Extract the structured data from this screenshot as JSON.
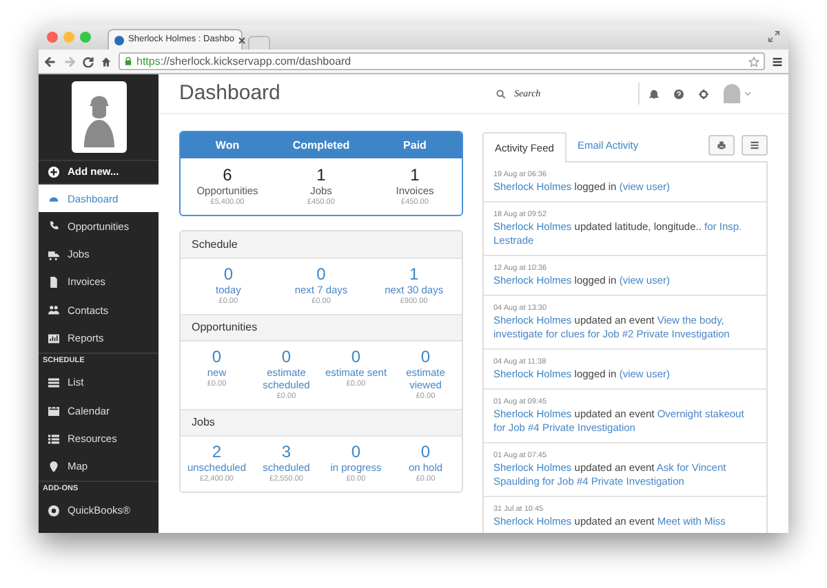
{
  "browser": {
    "tab_title": "Sherlock Holmes : Dashbo",
    "url_scheme": "https",
    "url_rest": "://sherlock.kickservapp.com/dashboard"
  },
  "sidebar": {
    "add_new": "Add new...",
    "sections": [
      {
        "items": [
          {
            "label": "Dashboard",
            "selected": true
          },
          {
            "label": "Opportunities",
            "selected": false
          },
          {
            "label": "Jobs",
            "selected": false
          },
          {
            "label": "Invoices",
            "selected": false
          },
          {
            "label": "Contacts",
            "selected": false
          },
          {
            "label": "Reports",
            "selected": false
          }
        ]
      },
      {
        "heading": "SCHEDULE",
        "items": [
          {
            "label": "List",
            "selected": false
          },
          {
            "label": "Calendar",
            "selected": false
          },
          {
            "label": "Resources",
            "selected": false
          },
          {
            "label": "Map",
            "selected": false
          }
        ]
      },
      {
        "heading": "ADD-ONS",
        "items": [
          {
            "label": "QuickBooks®",
            "selected": false
          }
        ]
      }
    ]
  },
  "page_title": "Dashboard",
  "search": {
    "placeholder": "Search"
  },
  "summary": [
    {
      "heading": "Won",
      "count": "6",
      "label": "Opportunities",
      "amount": "£5,400.00"
    },
    {
      "heading": "Completed",
      "count": "1",
      "label": "Jobs",
      "amount": "£450.00"
    },
    {
      "heading": "Paid",
      "count": "1",
      "label": "Invoices",
      "amount": "£450.00"
    }
  ],
  "sections": [
    {
      "title": "Schedule",
      "stats": [
        {
          "count": "0",
          "label": "today",
          "amount": "£0.00"
        },
        {
          "count": "0",
          "label": "next 7 days",
          "amount": "£0.00"
        },
        {
          "count": "1",
          "label": "next 30 days",
          "amount": "£900.00"
        }
      ]
    },
    {
      "title": "Opportunities",
      "stats": [
        {
          "count": "0",
          "label": "new",
          "amount": "£0.00"
        },
        {
          "count": "0",
          "label": "estimate scheduled",
          "amount": "£0.00"
        },
        {
          "count": "0",
          "label": "estimate sent",
          "amount": "£0.00"
        },
        {
          "count": "0",
          "label": "estimate viewed",
          "amount": "£0.00"
        }
      ]
    },
    {
      "title": "Jobs",
      "stats": [
        {
          "count": "2",
          "label": "unscheduled",
          "amount": "£2,400.00"
        },
        {
          "count": "3",
          "label": "scheduled",
          "amount": "£2,550.00"
        },
        {
          "count": "0",
          "label": "in progress",
          "amount": "£0.00"
        },
        {
          "count": "0",
          "label": "on hold",
          "amount": "£0.00"
        }
      ]
    }
  ],
  "tabs": [
    {
      "label": "Activity Feed",
      "selected": true
    },
    {
      "label": "Email Activity",
      "selected": false
    }
  ],
  "feed": [
    {
      "time": "19 Aug at 06:36",
      "user": "Sherlock Holmes",
      "action": "logged in",
      "target": "(view user)"
    },
    {
      "time": "18 Aug at 09:52",
      "user": "Sherlock Holmes",
      "action": "updated latitude, longitude..",
      "target": "for Insp. Lestrade"
    },
    {
      "time": "12 Aug at 10:36",
      "user": "Sherlock Holmes",
      "action": "logged in",
      "target": "(view user)"
    },
    {
      "time": "04 Aug at 13:30",
      "user": "Sherlock Holmes",
      "action": "updated an event",
      "target": "View the body, investigate for clues for Job #2 Private Investigation"
    },
    {
      "time": "04 Aug at 11:38",
      "user": "Sherlock Holmes",
      "action": "logged in",
      "target": "(view user)"
    },
    {
      "time": "01 Aug at 09:45",
      "user": "Sherlock Holmes",
      "action": "updated an event",
      "target": "Overnight stakeout for Job #4 Private Investigation"
    },
    {
      "time": "01 Aug at 07:45",
      "user": "Sherlock Holmes",
      "action": "updated an event",
      "target": "Ask for Vincent Spaulding for Job #4 Private Investigation"
    },
    {
      "time": "31 Jul at 10:45",
      "user": "Sherlock Holmes",
      "action": "updated an event",
      "target": "Meet with Miss"
    }
  ]
}
